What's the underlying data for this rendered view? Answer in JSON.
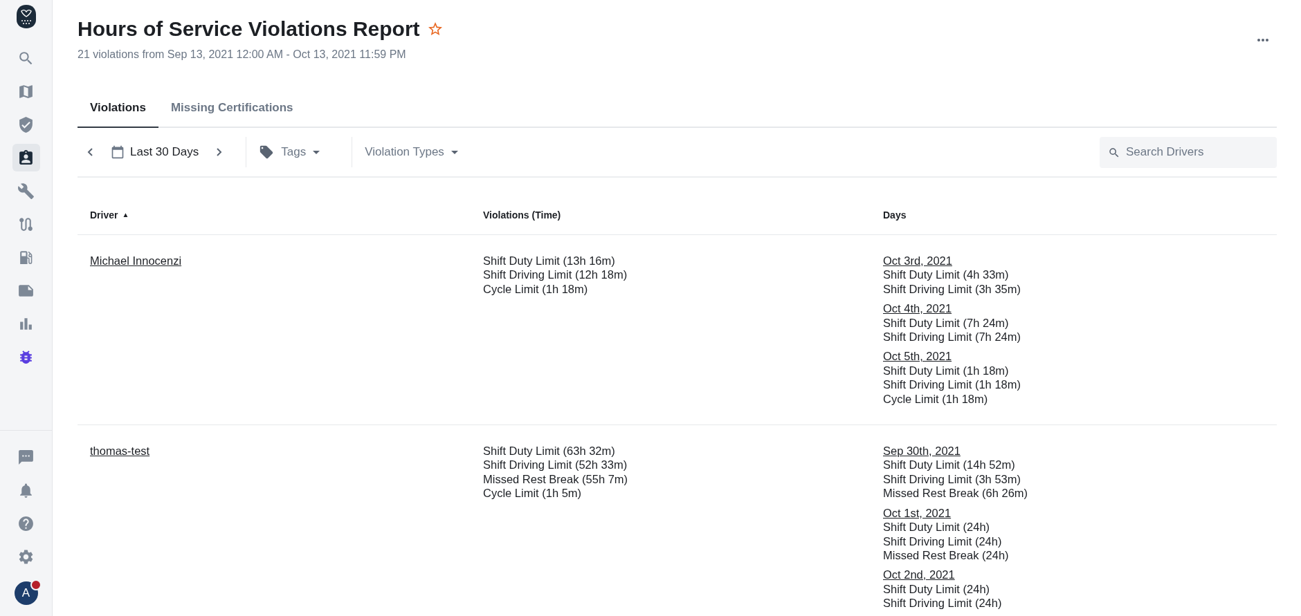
{
  "sidebar": {
    "items": [
      {
        "selected": false
      },
      {
        "selected": false
      },
      {
        "selected": false
      },
      {
        "selected": true
      },
      {
        "selected": false
      },
      {
        "selected": false
      },
      {
        "selected": false
      },
      {
        "selected": false
      },
      {
        "selected": false
      },
      {
        "selected": false,
        "color": "#5a3ee0"
      }
    ],
    "bottom_items": [
      {
        "selected": false
      },
      {
        "selected": false
      },
      {
        "selected": false
      },
      {
        "selected": false
      }
    ],
    "avatar": {
      "initial": "A",
      "has_notification": true
    }
  },
  "header": {
    "title": "Hours of Service Violations Report",
    "subtitle": "21 violations from Sep 13, 2021 12:00 AM - Oct 13, 2021 11:59 PM"
  },
  "tabs": [
    {
      "label": "Violations",
      "selected": true
    },
    {
      "label": "Missing Certifications",
      "selected": false
    }
  ],
  "toolbar": {
    "date_range": "Last 30 Days",
    "filters": [
      "Tags",
      "Violation Types"
    ],
    "search": {
      "placeholder": "Search Drivers"
    }
  },
  "table": {
    "columns": [
      {
        "label": "Driver",
        "sort_indicator": "▲"
      },
      {
        "label": "Violations (Time)"
      },
      {
        "label": "Days"
      }
    ],
    "rows": [
      {
        "driver": "Michael Innocenzi",
        "violations": [
          "Shift Duty Limit (13h 16m)",
          "Shift Driving Limit (12h 18m)",
          "Cycle Limit (1h 18m)"
        ],
        "days": [
          {
            "date": "Oct 3rd, 2021",
            "items": [
              "Shift Duty Limit (4h 33m)",
              "Shift Driving Limit (3h 35m)"
            ]
          },
          {
            "date": "Oct 4th, 2021",
            "items": [
              "Shift Duty Limit (7h 24m)",
              "Shift Driving Limit (7h 24m)"
            ]
          },
          {
            "date": "Oct 5th, 2021",
            "items": [
              "Shift Duty Limit (1h 18m)",
              "Shift Driving Limit (1h 18m)",
              "Cycle Limit (1h 18m)"
            ]
          }
        ]
      },
      {
        "driver": "thomas-test",
        "violations": [
          "Shift Duty Limit (63h 32m)",
          "Shift Driving Limit (52h 33m)",
          "Missed Rest Break (55h 7m)",
          "Cycle Limit (1h 5m)"
        ],
        "days": [
          {
            "date": "Sep 30th, 2021",
            "items": [
              "Shift Duty Limit (14h 52m)",
              "Shift Driving Limit (3h 53m)",
              "Missed Rest Break (6h 26m)"
            ]
          },
          {
            "date": "Oct 1st, 2021",
            "items": [
              "Shift Duty Limit (24h)",
              "Shift Driving Limit (24h)",
              "Missed Rest Break (24h)"
            ]
          },
          {
            "date": "Oct 2nd, 2021",
            "items": [
              "Shift Duty Limit (24h)",
              "Shift Driving Limit (24h)"
            ]
          }
        ]
      }
    ]
  }
}
